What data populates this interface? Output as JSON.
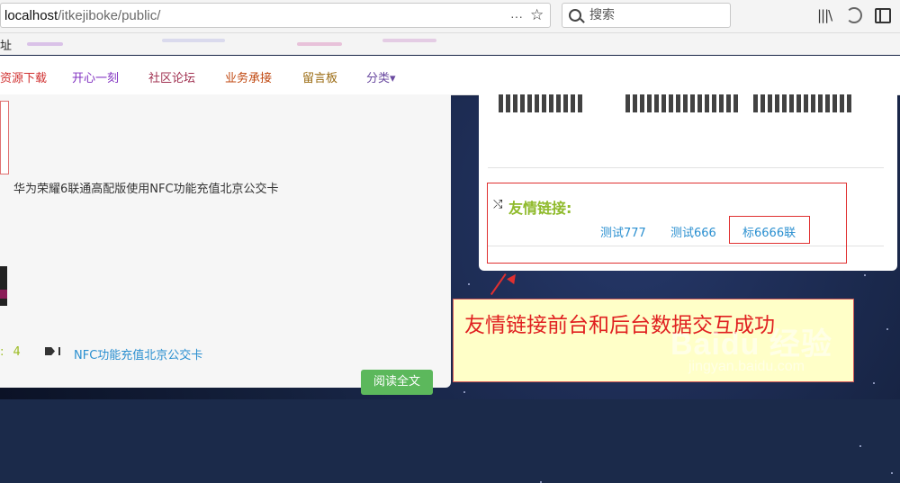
{
  "browser": {
    "url_host": "localhost",
    "url_path": "/itkejiboke/public/",
    "url_dots": "···",
    "search_placeholder": "搜索",
    "bookmarks_label": "址"
  },
  "nav": {
    "items": [
      "资源下载",
      "开心一刻",
      "社区论坛",
      "业务承接",
      "留言板",
      "分类▾"
    ],
    "colors": [
      "#d03030",
      "#8030c0",
      "#a03050",
      "#c04810",
      "#9a6a10",
      "#6a4aa0"
    ]
  },
  "article": {
    "title": "华为荣耀6联通高配版使用NFC功能充值北京公交卡",
    "meta_prefix": ":",
    "meta_count": "4",
    "tag": "NFC功能充值北京公交卡",
    "read_more": "阅读全文"
  },
  "friend_links": {
    "heading": "友情链接:",
    "items": [
      "测试777",
      "测试666",
      "标6666联"
    ]
  },
  "annotation": {
    "callout": "友情链接前台和后台数据交互成功",
    "accent_color": "#e03030"
  },
  "watermark": {
    "brand": "Baidu 经验",
    "url": "jingyan.baidu.com"
  }
}
